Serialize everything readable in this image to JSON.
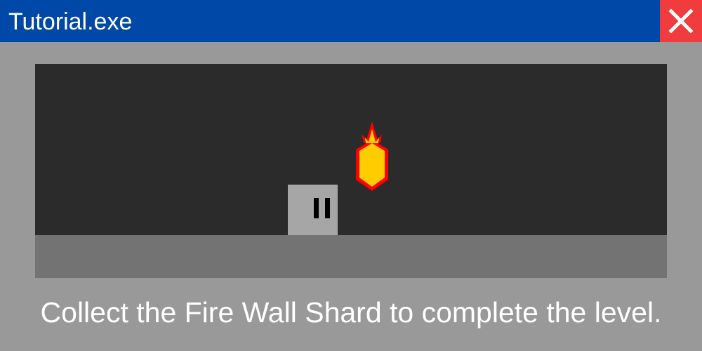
{
  "window": {
    "title": "Tutorial.exe",
    "close_icon": "close-icon"
  },
  "game": {
    "player_icon": "player-block",
    "collectible_icon": "fire-wall-shard-icon",
    "colors": {
      "titlebar": "#0048a8",
      "close": "#f03c3c",
      "background": "#2b2b2b",
      "ground": "#737373",
      "player": "#a6a6a6",
      "shard_fill": "#ffcc00",
      "shard_flame": "#ff0000"
    }
  },
  "instruction": "Collect the Fire Wall Shard to complete the level."
}
